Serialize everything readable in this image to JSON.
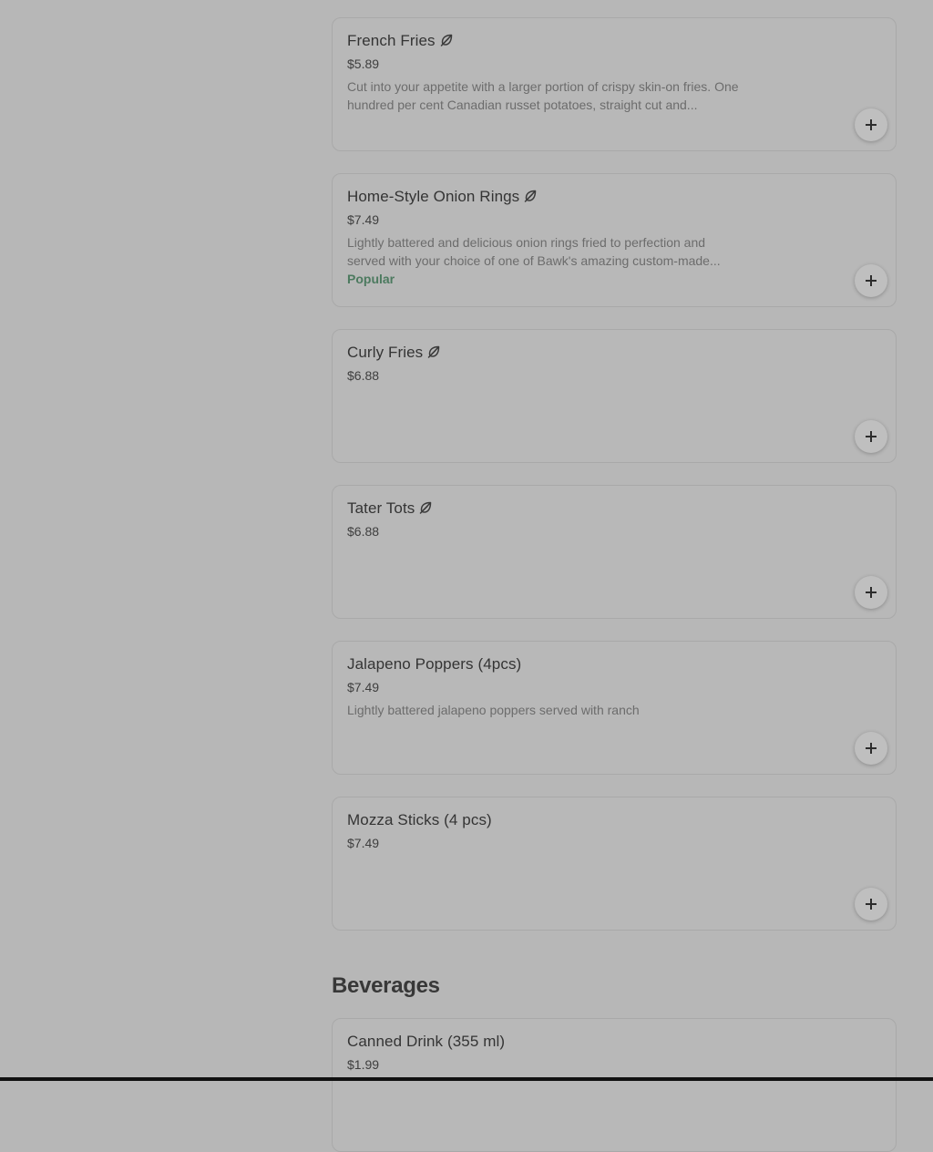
{
  "items": [
    {
      "name": "French Fries",
      "vegetarian": true,
      "price": "$5.89",
      "description": "Cut into your appetite with a larger portion of crispy skin-on fries. One hundred per cent Canadian russet potatoes, straight cut and...",
      "badge": ""
    },
    {
      "name": "Home-Style Onion Rings",
      "vegetarian": true,
      "price": "$7.49",
      "description": "Lightly battered and delicious onion rings fried to perfection and served with your choice of one of Bawk's amazing custom-made...",
      "badge": "Popular"
    },
    {
      "name": "Curly Fries",
      "vegetarian": true,
      "price": "$6.88",
      "description": "",
      "badge": ""
    },
    {
      "name": "Tater Tots",
      "vegetarian": true,
      "price": "$6.88",
      "description": "",
      "badge": ""
    },
    {
      "name": "Jalapeno Poppers (4pcs)",
      "vegetarian": false,
      "price": "$7.49",
      "description": "Lightly battered jalapeno poppers served with ranch",
      "badge": ""
    },
    {
      "name": "Mozza Sticks (4 pcs)",
      "vegetarian": false,
      "price": "$7.49",
      "description": "",
      "badge": ""
    }
  ],
  "section_heading": "Beverages",
  "beverage_items": [
    {
      "name": "Canned Drink (355 ml)",
      "vegetarian": false,
      "price": "$1.99",
      "description": "",
      "badge": ""
    }
  ],
  "icons": {
    "vegetarian": "leaf-icon",
    "add": "plus-icon"
  },
  "colors": {
    "page_background": "#b7b7b7",
    "popular_badge": "#4c7a5f"
  }
}
